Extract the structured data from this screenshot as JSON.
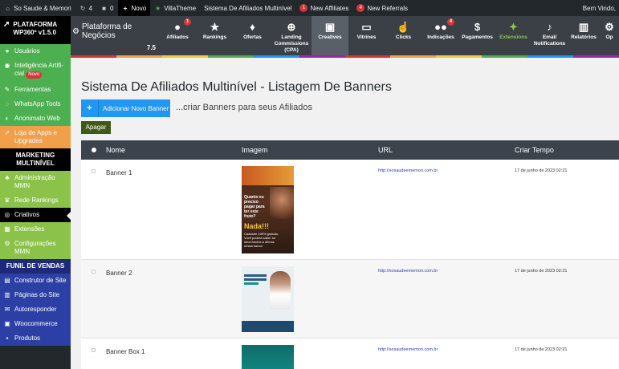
{
  "adminbar": {
    "site_name": "So Saude & Memori",
    "updates_count": "4",
    "comments_count": "0",
    "new_label": "Novo",
    "theme_label": "VillaTheme",
    "network_label": "Sistema De Afiliados Multinível",
    "affiliates_badge": "1",
    "affiliates_label": "New Affiliates",
    "referrals_badge": "4",
    "referrals_label": "New Referrals",
    "greeting": "Bem Vindo,"
  },
  "sidebar": {
    "brand_line1": "PLATAFORMA",
    "brand_line2": "WP360º v1.5.0",
    "items": [
      {
        "label": "Usuários",
        "icon": "user-icon"
      },
      {
        "label": "Inteligência Artifi-cial",
        "badge": "Novo",
        "icon": "ai-icon"
      },
      {
        "label": "Ferramentas",
        "icon": "wrench-icon"
      },
      {
        "label": "WhatsApp Tools",
        "icon": "whatsapp-icon"
      },
      {
        "label": "Anonimato Web",
        "icon": "incognito-icon"
      },
      {
        "label": "Loja de Apps e Upgrades",
        "icon": "rocket-icon"
      }
    ],
    "section_mkt": "MARKETING MULTINÍVEL",
    "mkt_items": [
      {
        "label": "Administração MMN",
        "icon": "org-icon"
      },
      {
        "label": "Rede Rankings",
        "icon": "trophy-icon"
      },
      {
        "label": "Criativos",
        "icon": "eye-icon"
      },
      {
        "label": "Extensões",
        "icon": "grid-icon"
      },
      {
        "label": "Configurações MMN",
        "icon": "gears-icon"
      }
    ],
    "section_funil": "FUNIL DE VENDAS",
    "funil_items": [
      {
        "label": "Construtor de Site",
        "icon": "builder-icon"
      },
      {
        "label": "Páginas do Site",
        "icon": "pages-icon"
      },
      {
        "label": "Autoresponder",
        "icon": "mail-icon"
      },
      {
        "label": "Woocommerce",
        "icon": "woo-icon"
      },
      {
        "label": "Produtos",
        "icon": "box-icon"
      }
    ]
  },
  "topnav": {
    "brand": "Plataforma de Negócios",
    "version": "7.5",
    "items": [
      {
        "label": "Afiliados",
        "icon": "user-icon",
        "badge": "1"
      },
      {
        "label": "Rankings",
        "icon": "star-icon"
      },
      {
        "label": "Ofertas",
        "icon": "gift-icon"
      },
      {
        "label": "Landing Commissions (CPA)",
        "icon": "plus-circle-icon"
      },
      {
        "label": "Creatives",
        "icon": "image-icon"
      },
      {
        "label": "Vitrines",
        "icon": "laptop-icon"
      },
      {
        "label": "Clicks",
        "icon": "pointer-icon"
      },
      {
        "label": "Indicações",
        "icon": "users-icon",
        "badge": "4"
      },
      {
        "label": "Pagamentos",
        "icon": "money-icon"
      },
      {
        "label": "Extensions",
        "icon": "wand-icon"
      },
      {
        "label": "Email Notifications",
        "icon": "bell-icon"
      },
      {
        "label": "Relatórios",
        "icon": "chart-icon"
      },
      {
        "label": "Op",
        "icon": "gear-icon"
      }
    ],
    "strip_colors": [
      "#d63638",
      "#f0a04b",
      "#f6c542",
      "#4caf50",
      "#2196f3",
      "#9c27b0"
    ]
  },
  "main": {
    "title": "Sistema De Afiliados Multinível - Listagem De Banners",
    "add_button": "Adicionar Novo Banner",
    "subtitle": "...criar Banners para seus Afiliados",
    "delete_button": "Apagar",
    "columns": [
      "Nome",
      "Imagem",
      "URL",
      "Criar Tempo"
    ],
    "rows": [
      {
        "name": "Banner 1",
        "url": "http://sosaudeememori.com.br",
        "time": "17 de junho de 2023 02:21",
        "img_text": [
          "Quanto eu preciso pagar para ter este fruto?",
          "Nada!!!",
          "Cadastre 100% gratuito. Você poderá saber se seus fundos a ótimos nessa banca"
        ]
      },
      {
        "name": "Banner 2",
        "url": "http://sosaudeememori.com.br",
        "time": "17 de junho de 2023 02:21",
        "img_text": [
          "Oportunidade para ter o seu negócio próprio",
          "Clique Aqui"
        ]
      },
      {
        "name": "Banner Box 1",
        "url": "http://sosaudeememori.com.br",
        "time": "17 de junho de 2023 02:21",
        "img_text": []
      }
    ]
  }
}
